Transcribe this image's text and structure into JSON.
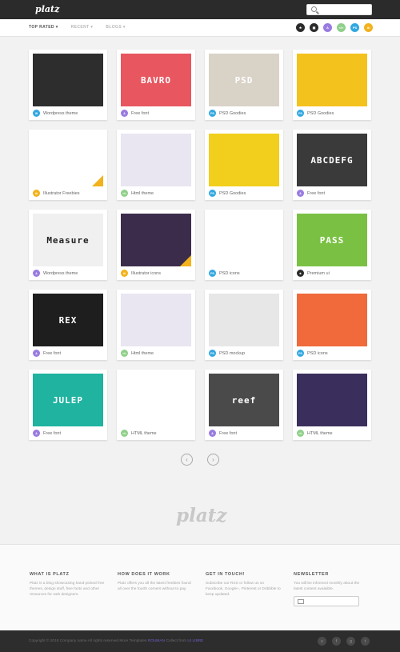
{
  "header": {
    "logo": "platz",
    "search_placeholder": ""
  },
  "filters": [
    {
      "label": "TOP RATED ▾",
      "active": true
    },
    {
      "label": "RECENT ▾",
      "active": false
    },
    {
      "label": "BLOGS ▾",
      "active": false
    }
  ],
  "categories": [
    {
      "name": "all",
      "short": "★",
      "color": "#2b2b2b"
    },
    {
      "name": "icons",
      "short": "▣",
      "color": "#2b2b2b"
    },
    {
      "name": "fonts",
      "short": "A",
      "color": "#9a7be0"
    },
    {
      "name": "html",
      "short": "</>",
      "color": "#8fcf8a"
    },
    {
      "name": "psd",
      "short": "PS",
      "color": "#31a8e0"
    },
    {
      "name": "illustrator",
      "short": "Ai",
      "color": "#f2b21b"
    }
  ],
  "items": [
    {
      "caption": "Wordpress theme",
      "badge": "W",
      "badge_color": "#31a8e0",
      "thumb_bg": "#2d2d2d",
      "thumb_text": "",
      "thumb_fg": "#fff"
    },
    {
      "caption": "Free font",
      "badge": "A",
      "badge_color": "#9a7be0",
      "thumb_bg": "#e8565f",
      "thumb_text": "BAVRO",
      "thumb_fg": "#fff"
    },
    {
      "caption": "PSD Goodies",
      "badge": "PS",
      "badge_color": "#31a8e0",
      "thumb_bg": "#d9d2c7",
      "thumb_text": "PSD",
      "thumb_fg": "#ffffff"
    },
    {
      "caption": "PSD Goodies",
      "badge": "PS",
      "badge_color": "#31a8e0",
      "thumb_bg": "#f4c21c",
      "thumb_text": "",
      "thumb_fg": "#fff"
    },
    {
      "caption": "Illustrator Freebies",
      "badge": "Ai",
      "badge_color": "#f2b21b",
      "thumb_bg": "#ffffff",
      "thumb_text": "",
      "thumb_fg": "#333"
    },
    {
      "caption": "Html theme",
      "badge": "</>",
      "badge_color": "#8fcf8a",
      "thumb_bg": "#e9e6f2",
      "thumb_text": "",
      "thumb_fg": "#fff"
    },
    {
      "caption": "PSD Goodies",
      "badge": "PS",
      "badge_color": "#31a8e0",
      "thumb_bg": "#f2cf1c",
      "thumb_text": "",
      "thumb_fg": "#fff"
    },
    {
      "caption": "Free font",
      "badge": "A",
      "badge_color": "#9a7be0",
      "thumb_bg": "#3a3a3a",
      "thumb_text": "ABCDEFG",
      "thumb_fg": "#fff"
    },
    {
      "caption": "Wordpress theme",
      "badge": "A",
      "badge_color": "#9a7be0",
      "thumb_bg": "#f0f0f0",
      "thumb_text": "Measure",
      "thumb_fg": "#222"
    },
    {
      "caption": "Illustrator icons",
      "badge": "Ai",
      "badge_color": "#f2b21b",
      "thumb_bg": "#3c2c4c",
      "thumb_text": "",
      "thumb_fg": "#f09a4c"
    },
    {
      "caption": "PSD icons",
      "badge": "PS",
      "badge_color": "#31a8e0",
      "thumb_bg": "#ffffff",
      "thumb_text": "",
      "thumb_fg": "#333"
    },
    {
      "caption": "Premium ui",
      "badge": "★",
      "badge_color": "#2b2b2b",
      "thumb_bg": "#7ac143",
      "thumb_text": "PASS",
      "thumb_fg": "#fff"
    },
    {
      "caption": "Free font",
      "badge": "A",
      "badge_color": "#9a7be0",
      "thumb_bg": "#1e1e1e",
      "thumb_text": "REX",
      "thumb_fg": "#fff"
    },
    {
      "caption": "Html theme",
      "badge": "</>",
      "badge_color": "#8fcf8a",
      "thumb_bg": "#e9e6f2",
      "thumb_text": "",
      "thumb_fg": "#fff"
    },
    {
      "caption": "PSD mockup",
      "badge": "PS",
      "badge_color": "#31a8e0",
      "thumb_bg": "#e7e7e7",
      "thumb_text": "",
      "thumb_fg": "#333"
    },
    {
      "caption": "PSD icons",
      "badge": "PS",
      "badge_color": "#31a8e0",
      "thumb_bg": "#f06a3b",
      "thumb_text": "",
      "thumb_fg": "#fff"
    },
    {
      "caption": "Free font",
      "badge": "A",
      "badge_color": "#9a7be0",
      "thumb_bg": "#1fb3a0",
      "thumb_text": "JULEP",
      "thumb_fg": "#fff"
    },
    {
      "caption": "HTML theme",
      "badge": "</>",
      "badge_color": "#8fcf8a",
      "thumb_bg": "#ffffff",
      "thumb_text": "",
      "thumb_fg": "#333"
    },
    {
      "caption": "Free font",
      "badge": "A",
      "badge_color": "#9a7be0",
      "thumb_bg": "#4a4a4a",
      "thumb_text": "reef",
      "thumb_fg": "#fff"
    },
    {
      "caption": "HTML theme",
      "badge": "</>",
      "badge_color": "#8fcf8a",
      "thumb_bg": "#3a2f5c",
      "thumb_text": "",
      "thumb_fg": "#fff"
    }
  ],
  "pagination": {
    "prev": "‹",
    "next": "›"
  },
  "bottom_logo": "platz",
  "footer": {
    "col1": {
      "title": "WHAT IS PLATZ",
      "text": "Platz is a blog showcasing hand-picked free themes, design stuff, free fonts and other resources for web designers."
    },
    "col2": {
      "title": "HOW DOES IT WORK",
      "text": "Platz offers you all the latest freebies found all over the fourth corners without to pay."
    },
    "col3": {
      "title": "GET IN TOUCH!",
      "text": "Subscribe our RSS or follow us on Facebook, Google+, Pinterest or Dribbble to keep updated."
    },
    "col4": {
      "title": "NEWSLETTER",
      "text": "You will be informed monthly about the latest content avalaible."
    }
  },
  "copyright": {
    "text": "Copyright © 2018 Company name All rights reserved More Templates",
    "link1": "ROUMAN",
    "mid": "Collect from",
    "link2": "UI LIBRE"
  },
  "socials": [
    "s",
    "f",
    "g",
    "t"
  ]
}
